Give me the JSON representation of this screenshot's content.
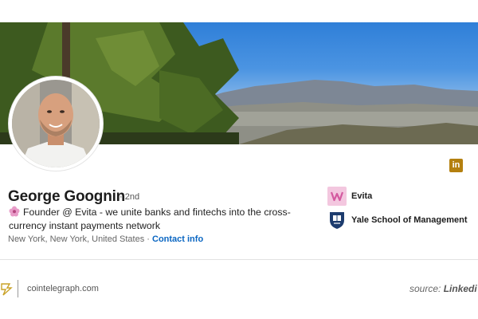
{
  "profile": {
    "name": "George Goognin",
    "degree": "· 2nd",
    "headline": "Founder @ Evita - we unite banks and fintechs into the cross-currency instant payments network",
    "location": "New York, New York, United States ·",
    "contact_link": "Contact info"
  },
  "organizations": [
    {
      "name": "Evita",
      "icon": "evita-logo-icon"
    },
    {
      "name": "Yale School of Management",
      "icon": "yale-shield-icon"
    }
  ],
  "linkedin_icon_label": "in",
  "footer": {
    "site": "cointelegraph.com",
    "source_prefix": "source:",
    "source_brand": "Linkedi"
  },
  "colors": {
    "link": "#0a66c2",
    "linkedin_badge": "#b4800f",
    "evita_pink": "#e89bc8",
    "yale_navy": "#1d3c6e"
  }
}
